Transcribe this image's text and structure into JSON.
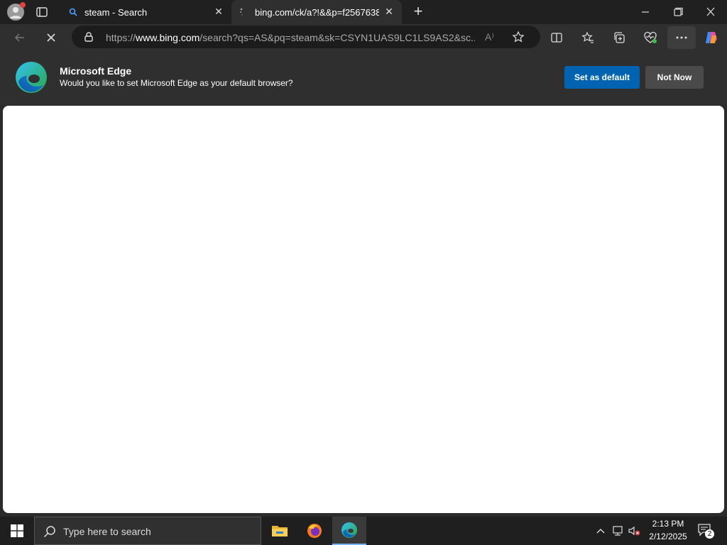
{
  "tabs": [
    {
      "title": "steam - Search",
      "close": "✕"
    },
    {
      "title": "bing.com/ck/a?!&&p=f2567638a",
      "close": "✕"
    }
  ],
  "new_tab": "+",
  "address": {
    "prefix": "https://",
    "host": "www.bing.com",
    "rest": "/search?qs=AS&pq=steam&sk=CSYN1UAS9LC1LS9AS2&sc..."
  },
  "read_aloud": "A⁾",
  "infobar": {
    "title": "Microsoft Edge",
    "message": "Would you like to set Microsoft Edge as your default browser?",
    "primary_button": "Set as default",
    "secondary_button": "Not Now"
  },
  "taskbar": {
    "search_placeholder": "Type here to search",
    "time": "2:13 PM",
    "date": "2/12/2025",
    "notification_count": "2"
  },
  "colors": {
    "accent": "#0063b1",
    "chrome_bg": "#2f2f2f",
    "tabstrip_bg": "#202020"
  }
}
